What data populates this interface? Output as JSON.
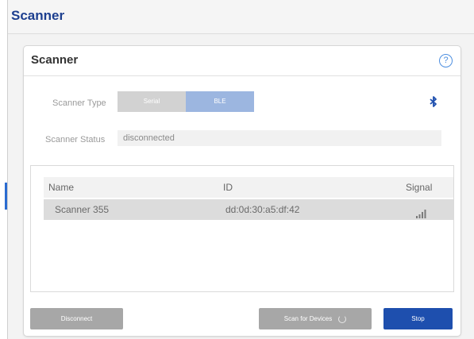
{
  "page": {
    "title": "Scanner"
  },
  "card": {
    "title": "Scanner",
    "help_icon_glyph": "?"
  },
  "scanner_type": {
    "label": "Scanner Type",
    "options": [
      "Serial",
      "BLE"
    ],
    "selected": "BLE",
    "icon": "bluetooth-icon"
  },
  "scanner_status": {
    "label": "Scanner Status",
    "value": "disconnected"
  },
  "devices_table": {
    "columns": [
      "Name",
      "ID",
      "Signal"
    ],
    "rows": [
      {
        "name": "Scanner 355",
        "id": "dd:0d:30:a5:df:42",
        "signal_icon": "signal-bars-icon"
      }
    ]
  },
  "actions": {
    "disconnect_label": "Disconnect",
    "scan_label": "Scan for Devices",
    "stop_label": "Stop"
  },
  "colors": {
    "brand_blue": "#1d3f8f",
    "primary_button": "#1e4fae",
    "selected_segment": "#9cb6e0",
    "disabled_button": "#a7a7a7"
  }
}
